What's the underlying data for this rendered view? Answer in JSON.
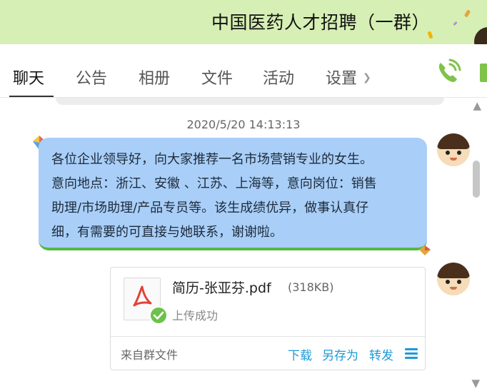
{
  "window": {
    "title": "中国医药人才招聘（一群）"
  },
  "tabs": [
    {
      "label": "聊天",
      "active": true
    },
    {
      "label": "公告"
    },
    {
      "label": "相册"
    },
    {
      "label": "文件"
    },
    {
      "label": "活动"
    },
    {
      "label": "设置"
    }
  ],
  "icons": {
    "call": "phone-icon",
    "video": "video-icon",
    "collapse_up": "chevron-up-icon",
    "collapse_down": "chevron-down-icon",
    "pdf": "pdf-icon",
    "status_ok": "check-icon",
    "more": "menu-icon"
  },
  "colors": {
    "titlebar_bg": "#d6efb4",
    "bubble_bg": "#a9cff8",
    "bubble_border": "#57b847",
    "accent": "#1e9ad6",
    "call_icon": "#7fc34a",
    "success": "#6cc24a"
  },
  "chat": {
    "timestamp": "2020/5/20 14:13:13",
    "message_lines": [
      "各位企业领导好，向大家推荐一名市场营销专业的女生。",
      "意向地点：浙江、安徽 、江苏、上海等，意向岗位：销售",
      "助理/市场助理/产品专员等。该生成绩优异，做事认真仔",
      "细，有需要的可直接与她联系，谢谢啦。"
    ]
  },
  "file": {
    "name": "简历-张亚芬.pdf",
    "size": "(318KB)",
    "status": "上传成功",
    "source": "来自群文件",
    "actions": [
      "下载",
      "另存为",
      "转发"
    ]
  }
}
